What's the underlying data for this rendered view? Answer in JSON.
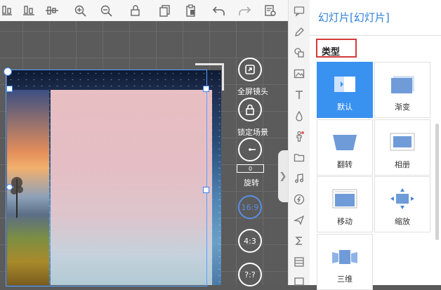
{
  "toolbar": {
    "icons": [
      "align-bottom-icon",
      "align-center-icon",
      "zoom-in-icon",
      "zoom-out-icon",
      "lock-icon",
      "copy-icon",
      "paste-icon",
      "undo-icon",
      "redo-icon",
      "settings-doc-icon"
    ]
  },
  "stage": {
    "controls": {
      "fullscreen_label": "全屏镜头",
      "lock_label": "锁定场景",
      "rotate_label": "旋转",
      "rotate_value": "0",
      "ratio_16_9": "16:9",
      "ratio_4_3": "4:3",
      "ratio_custom": "?:?"
    }
  },
  "right_panel": {
    "title": "幻灯片[幻灯片]",
    "section_label": "类型",
    "types": [
      {
        "label": "默认",
        "selected": true
      },
      {
        "label": "渐变",
        "selected": false
      },
      {
        "label": "翻转",
        "selected": false
      },
      {
        "label": "相册",
        "selected": false
      },
      {
        "label": "移动",
        "selected": false
      },
      {
        "label": "缩放",
        "selected": false
      },
      {
        "label": "三维",
        "selected": false
      }
    ]
  },
  "colors": {
    "accent_blue": "#3a92f0",
    "title_blue": "#2e7fd6",
    "highlight_red": "#d43a3a"
  }
}
